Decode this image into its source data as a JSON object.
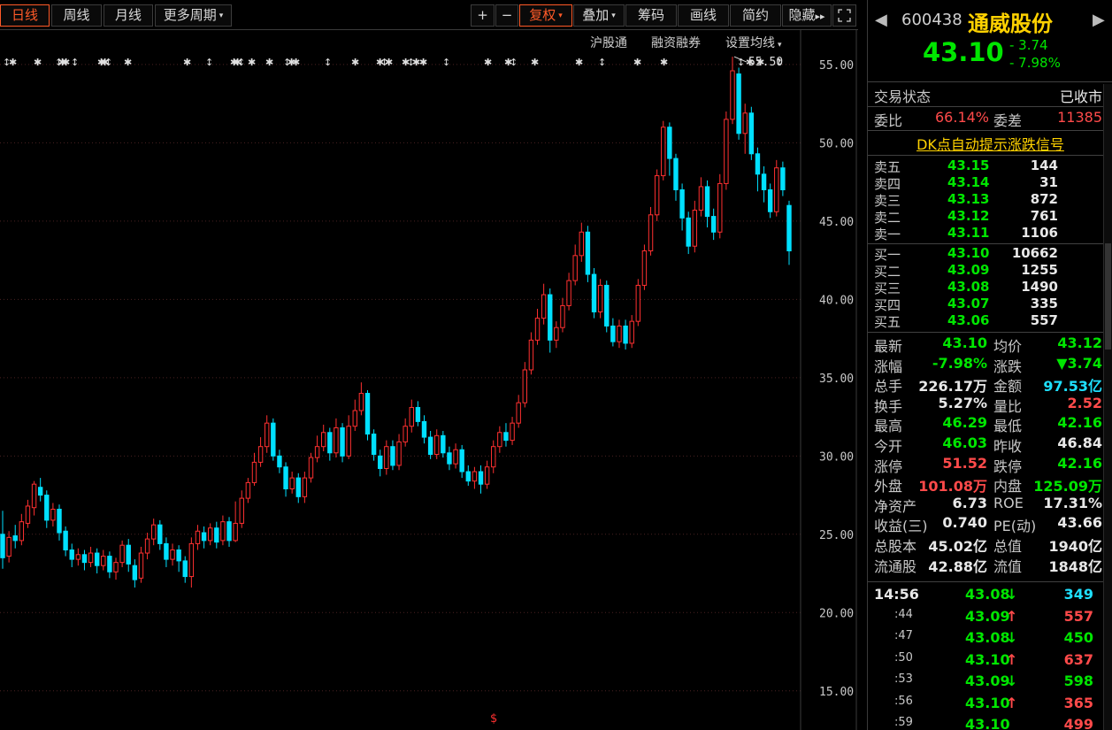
{
  "toolbar": {
    "periods": [
      "日线",
      "周线",
      "月线"
    ],
    "more_periods": "更多周期",
    "plus": "+",
    "minus": "−",
    "fuquan": "复权",
    "overlay": "叠加",
    "chip": "筹码",
    "draw": "画线",
    "simple": "简约",
    "hide": "隐藏",
    "arrows": "▸▸"
  },
  "chart_links": [
    "沪股通",
    "融资融券",
    "设置均线"
  ],
  "price_axis": [
    "55.00",
    "50.00",
    "45.00",
    "40.00",
    "35.00",
    "30.00",
    "25.00",
    "20.00",
    "15.00"
  ],
  "max_marker": "55.50",
  "bottom_marker": "$",
  "chart_data": {
    "type": "candlestick",
    "ylim": [
      12.5,
      57.2
    ],
    "up_color": "#ff3030",
    "down_color": "#00e0ff",
    "candles": [
      [
        25,
        23.5,
        26.5,
        22.8
      ],
      [
        23.6,
        24.8,
        25.2,
        23.2
      ],
      [
        24.9,
        24.6,
        25.6,
        24.1
      ],
      [
        24.6,
        25.8,
        26.3,
        24.3
      ],
      [
        25.7,
        26.8,
        27.2,
        25.4
      ],
      [
        26.7,
        28.2,
        28.4,
        26.2
      ],
      [
        28.0,
        27.5,
        28.6,
        27.1
      ],
      [
        27.5,
        25.9,
        27.8,
        25.4
      ],
      [
        25.9,
        26.6,
        27.0,
        25.5
      ],
      [
        26.6,
        25.1,
        26.9,
        24.6
      ],
      [
        25.2,
        24.0,
        25.5,
        23.6
      ],
      [
        24.0,
        23.4,
        24.4,
        22.9
      ],
      [
        23.4,
        23.7,
        24.1,
        23.0
      ],
      [
        23.7,
        23.2,
        24.0,
        22.7
      ],
      [
        23.2,
        23.8,
        24.2,
        22.9
      ],
      [
        23.8,
        23.0,
        24.1,
        22.5
      ],
      [
        23.0,
        23.6,
        24.0,
        22.7
      ],
      [
        23.6,
        22.6,
        23.9,
        22.2
      ],
      [
        22.6,
        23.2,
        23.5,
        22.1
      ],
      [
        23.2,
        24.3,
        24.6,
        22.9
      ],
      [
        24.3,
        23.1,
        24.7,
        22.6
      ],
      [
        23.0,
        22.1,
        23.4,
        21.6
      ],
      [
        22.2,
        23.8,
        24.2,
        21.9
      ],
      [
        23.8,
        24.7,
        25.1,
        23.4
      ],
      [
        24.7,
        25.6,
        26.0,
        24.3
      ],
      [
        25.6,
        24.4,
        25.9,
        24.0
      ],
      [
        24.4,
        23.4,
        24.8,
        22.9
      ],
      [
        23.4,
        24.0,
        24.4,
        23.0
      ],
      [
        24.0,
        23.3,
        24.3,
        22.6
      ],
      [
        23.3,
        22.3,
        23.6,
        21.9
      ],
      [
        22.3,
        24.4,
        24.8,
        21.6
      ],
      [
        24.4,
        25.2,
        25.6,
        24.0
      ],
      [
        25.1,
        24.6,
        25.5,
        24.1
      ],
      [
        24.6,
        25.4,
        25.7,
        24.3
      ],
      [
        25.4,
        24.5,
        25.8,
        24.1
      ],
      [
        24.6,
        25.8,
        26.2,
        24.3
      ],
      [
        25.8,
        24.6,
        26.1,
        24.2
      ],
      [
        24.6,
        25.7,
        27.1,
        24.5
      ],
      [
        25.7,
        27.3,
        27.8,
        25.4
      ],
      [
        27.3,
        28.3,
        28.6,
        27.0
      ],
      [
        28.3,
        29.6,
        30.2,
        28.1
      ],
      [
        29.6,
        30.6,
        31.2,
        29.3
      ],
      [
        30.6,
        32.1,
        32.6,
        30.2
      ],
      [
        32.1,
        30.0,
        32.4,
        29.7
      ],
      [
        30.0,
        29.3,
        30.4,
        28.9
      ],
      [
        29.3,
        27.9,
        29.6,
        27.4
      ],
      [
        27.9,
        28.6,
        29.0,
        27.6
      ],
      [
        28.6,
        27.4,
        28.9,
        27.0
      ],
      [
        27.4,
        28.6,
        29.0,
        27.0
      ],
      [
        28.6,
        29.9,
        30.2,
        28.3
      ],
      [
        29.9,
        30.6,
        31.3,
        29.6
      ],
      [
        30.6,
        31.5,
        32.0,
        30.3
      ],
      [
        31.5,
        30.2,
        31.8,
        29.7
      ],
      [
        30.2,
        31.8,
        32.4,
        29.9
      ],
      [
        31.8,
        30.0,
        32.1,
        29.6
      ],
      [
        30.0,
        31.9,
        32.6,
        29.8
      ],
      [
        31.9,
        32.9,
        33.6,
        31.6
      ],
      [
        32.9,
        34.0,
        34.7,
        32.6
      ],
      [
        34.0,
        31.4,
        34.2,
        31.0
      ],
      [
        31.4,
        30.1,
        31.7,
        29.7
      ],
      [
        30.0,
        29.2,
        30.4,
        28.7
      ],
      [
        29.2,
        30.6,
        31.0,
        28.8
      ],
      [
        30.6,
        29.4,
        31.0,
        29.1
      ],
      [
        29.4,
        30.9,
        31.4,
        29.1
      ],
      [
        30.9,
        31.9,
        32.4,
        30.6
      ],
      [
        31.9,
        33.1,
        33.6,
        31.5
      ],
      [
        33.1,
        32.2,
        33.5,
        31.9
      ],
      [
        32.2,
        31.2,
        32.6,
        30.8
      ],
      [
        31.2,
        30.1,
        31.6,
        29.8
      ],
      [
        30.1,
        31.3,
        31.7,
        29.8
      ],
      [
        31.3,
        30.2,
        31.6,
        29.9
      ],
      [
        30.2,
        29.5,
        30.6,
        29.1
      ],
      [
        29.5,
        30.4,
        30.8,
        29.2
      ],
      [
        30.4,
        29.0,
        30.7,
        28.6
      ],
      [
        29.0,
        28.4,
        29.4,
        28.1
      ],
      [
        28.4,
        29.0,
        29.3,
        27.9
      ],
      [
        29.0,
        28.2,
        29.4,
        27.6
      ],
      [
        28.2,
        29.3,
        29.7,
        27.9
      ],
      [
        29.3,
        30.6,
        31.0,
        28.9
      ],
      [
        30.6,
        31.5,
        31.9,
        30.2
      ],
      [
        31.5,
        31.0,
        32.1,
        30.6
      ],
      [
        31.0,
        32.1,
        32.5,
        30.7
      ],
      [
        32.1,
        33.4,
        33.9,
        31.8
      ],
      [
        33.4,
        35.5,
        36.0,
        33.1
      ],
      [
        35.5,
        37.4,
        37.9,
        35.2
      ],
      [
        37.4,
        38.8,
        39.4,
        37.1
      ],
      [
        38.8,
        40.3,
        41.0,
        38.4
      ],
      [
        40.3,
        37.4,
        40.7,
        36.6
      ],
      [
        37.4,
        38.2,
        38.6,
        36.9
      ],
      [
        38.2,
        39.6,
        40.1,
        37.9
      ],
      [
        39.6,
        41.2,
        41.7,
        39.3
      ],
      [
        41.2,
        42.8,
        43.5,
        40.9
      ],
      [
        42.8,
        44.3,
        44.9,
        42.4
      ],
      [
        44.3,
        41.6,
        44.7,
        41.1
      ],
      [
        41.6,
        39.2,
        42.0,
        38.8
      ],
      [
        39.2,
        40.9,
        41.3,
        38.8
      ],
      [
        40.9,
        38.3,
        41.2,
        37.9
      ],
      [
        38.3,
        37.3,
        38.8,
        37.0
      ],
      [
        37.3,
        38.3,
        38.7,
        36.9
      ],
      [
        38.3,
        37.2,
        38.7,
        36.8
      ],
      [
        37.2,
        38.6,
        39.0,
        36.9
      ],
      [
        38.6,
        40.9,
        41.3,
        38.3
      ],
      [
        40.9,
        43.1,
        43.5,
        40.6
      ],
      [
        43.1,
        45.4,
        45.9,
        42.8
      ],
      [
        45.4,
        47.9,
        48.3,
        45.0
      ],
      [
        47.9,
        51.0,
        51.4,
        47.6
      ],
      [
        51.0,
        49.0,
        51.3,
        47.9
      ],
      [
        49.0,
        47.0,
        49.3,
        46.3
      ],
      [
        47.0,
        45.2,
        47.4,
        44.4
      ],
      [
        45.2,
        43.4,
        45.6,
        42.9
      ],
      [
        43.4,
        45.7,
        46.3,
        43.0
      ],
      [
        45.7,
        47.2,
        47.8,
        45.3
      ],
      [
        47.2,
        45.3,
        47.6,
        44.6
      ],
      [
        45.3,
        44.3,
        45.8,
        43.8
      ],
      [
        44.3,
        47.4,
        48.0,
        43.9
      ],
      [
        47.4,
        51.5,
        52.0,
        47.0
      ],
      [
        51.5,
        54.6,
        55.5,
        51.2
      ],
      [
        54.4,
        50.6,
        54.8,
        50.2
      ],
      [
        50.6,
        51.9,
        52.5,
        49.3
      ],
      [
        51.9,
        49.3,
        52.3,
        48.9
      ],
      [
        49.3,
        48.0,
        49.7,
        46.9
      ],
      [
        48.0,
        47.0,
        48.5,
        46.2
      ],
      [
        47.0,
        45.6,
        47.4,
        45.2
      ],
      [
        45.6,
        48.4,
        48.9,
        45.3
      ],
      [
        48.4,
        47.0,
        48.8,
        46.6
      ],
      [
        46.0,
        43.1,
        46.3,
        42.2
      ]
    ]
  },
  "stock": {
    "code": "600438",
    "name": "通威股份",
    "price": "43.10",
    "change": "- 3.74",
    "change_pct": "- 7.98%"
  },
  "status": {
    "label": "交易状态",
    "value": "已收市"
  },
  "webi": {
    "label1": "委比",
    "value1": "66.14%",
    "label2": "委差",
    "value2": "11385"
  },
  "dk_signal": "DK点自动提示涨跌信号",
  "sell_orders": [
    {
      "label": "卖五",
      "price": "43.15",
      "vol": "144"
    },
    {
      "label": "卖四",
      "price": "43.14",
      "vol": "31"
    },
    {
      "label": "卖三",
      "price": "43.13",
      "vol": "872"
    },
    {
      "label": "卖二",
      "price": "43.12",
      "vol": "761"
    },
    {
      "label": "卖一",
      "price": "43.11",
      "vol": "1106"
    }
  ],
  "buy_orders": [
    {
      "label": "买一",
      "price": "43.10",
      "vol": "10662"
    },
    {
      "label": "买二",
      "price": "43.09",
      "vol": "1255"
    },
    {
      "label": "买三",
      "price": "43.08",
      "vol": "1490"
    },
    {
      "label": "买四",
      "price": "43.07",
      "vol": "335"
    },
    {
      "label": "买五",
      "price": "43.06",
      "vol": "557"
    }
  ],
  "quote": [
    {
      "l1": "最新",
      "v1": "43.10",
      "c1": "g",
      "l2": "均价",
      "v2": "43.12",
      "c2": "g"
    },
    {
      "l1": "涨幅",
      "v1": "-7.98%",
      "c1": "g",
      "l2": "涨跌",
      "v2": "▼3.74",
      "c2": "g"
    },
    {
      "l1": "总手",
      "v1": "226.17万",
      "c1": "w",
      "l2": "金额",
      "v2": "97.53亿",
      "c2": "c"
    },
    {
      "l1": "换手",
      "v1": "5.27%",
      "c1": "w",
      "l2": "量比",
      "v2": "2.52",
      "c2": "r"
    },
    {
      "l1": "最高",
      "v1": "46.29",
      "c1": "g",
      "l2": "最低",
      "v2": "42.16",
      "c2": "g"
    },
    {
      "l1": "今开",
      "v1": "46.03",
      "c1": "g",
      "l2": "昨收",
      "v2": "46.84",
      "c2": "w"
    },
    {
      "l1": "涨停",
      "v1": "51.52",
      "c1": "r",
      "l2": "跌停",
      "v2": "42.16",
      "c2": "g"
    },
    {
      "l1": "外盘",
      "v1": "101.08万",
      "c1": "r",
      "l2": "内盘",
      "v2": "125.09万",
      "c2": "g"
    },
    {
      "l1": "净资产",
      "v1": "6.73",
      "c1": "w",
      "l2": "ROE",
      "v2": "17.31%",
      "c2": "w"
    },
    {
      "l1": "收益(三)",
      "v1": "0.740",
      "c1": "w",
      "l2": "PE(动)",
      "v2": "43.66",
      "c2": "w"
    },
    {
      "l1": "总股本",
      "v1": "45.02亿",
      "c1": "w",
      "l2": "总值",
      "v2": "1940亿",
      "c2": "w"
    },
    {
      "l1": "流通股",
      "v1": "42.88亿",
      "c1": "w",
      "l2": "流值",
      "v2": "1848亿",
      "c2": "w"
    }
  ],
  "ticks": [
    {
      "time": "14:56",
      "price": "43.08",
      "dir": "↓",
      "vol": "349",
      "pc": "g",
      "vc": "c"
    },
    {
      "time": ":44",
      "price": "43.09",
      "dir": "↑",
      "vol": "557",
      "pc": "g",
      "vc": "r"
    },
    {
      "time": ":47",
      "price": "43.08",
      "dir": "↓",
      "vol": "450",
      "pc": "g",
      "vc": "g"
    },
    {
      "time": ":50",
      "price": "43.10",
      "dir": "↑",
      "vol": "637",
      "pc": "g",
      "vc": "r"
    },
    {
      "time": ":53",
      "price": "43.09",
      "dir": "↓",
      "vol": "598",
      "pc": "g",
      "vc": "g"
    },
    {
      "time": ":56",
      "price": "43.10",
      "dir": "↑",
      "vol": "365",
      "pc": "g",
      "vc": "r"
    },
    {
      "time": ":59",
      "price": "43.10",
      "dir": "",
      "vol": "499",
      "pc": "g",
      "vc": "r"
    }
  ],
  "colors": {
    "up": "#ff3030",
    "down": "#00e0ff",
    "bg": "#000000",
    "grid": "#4a2222"
  }
}
